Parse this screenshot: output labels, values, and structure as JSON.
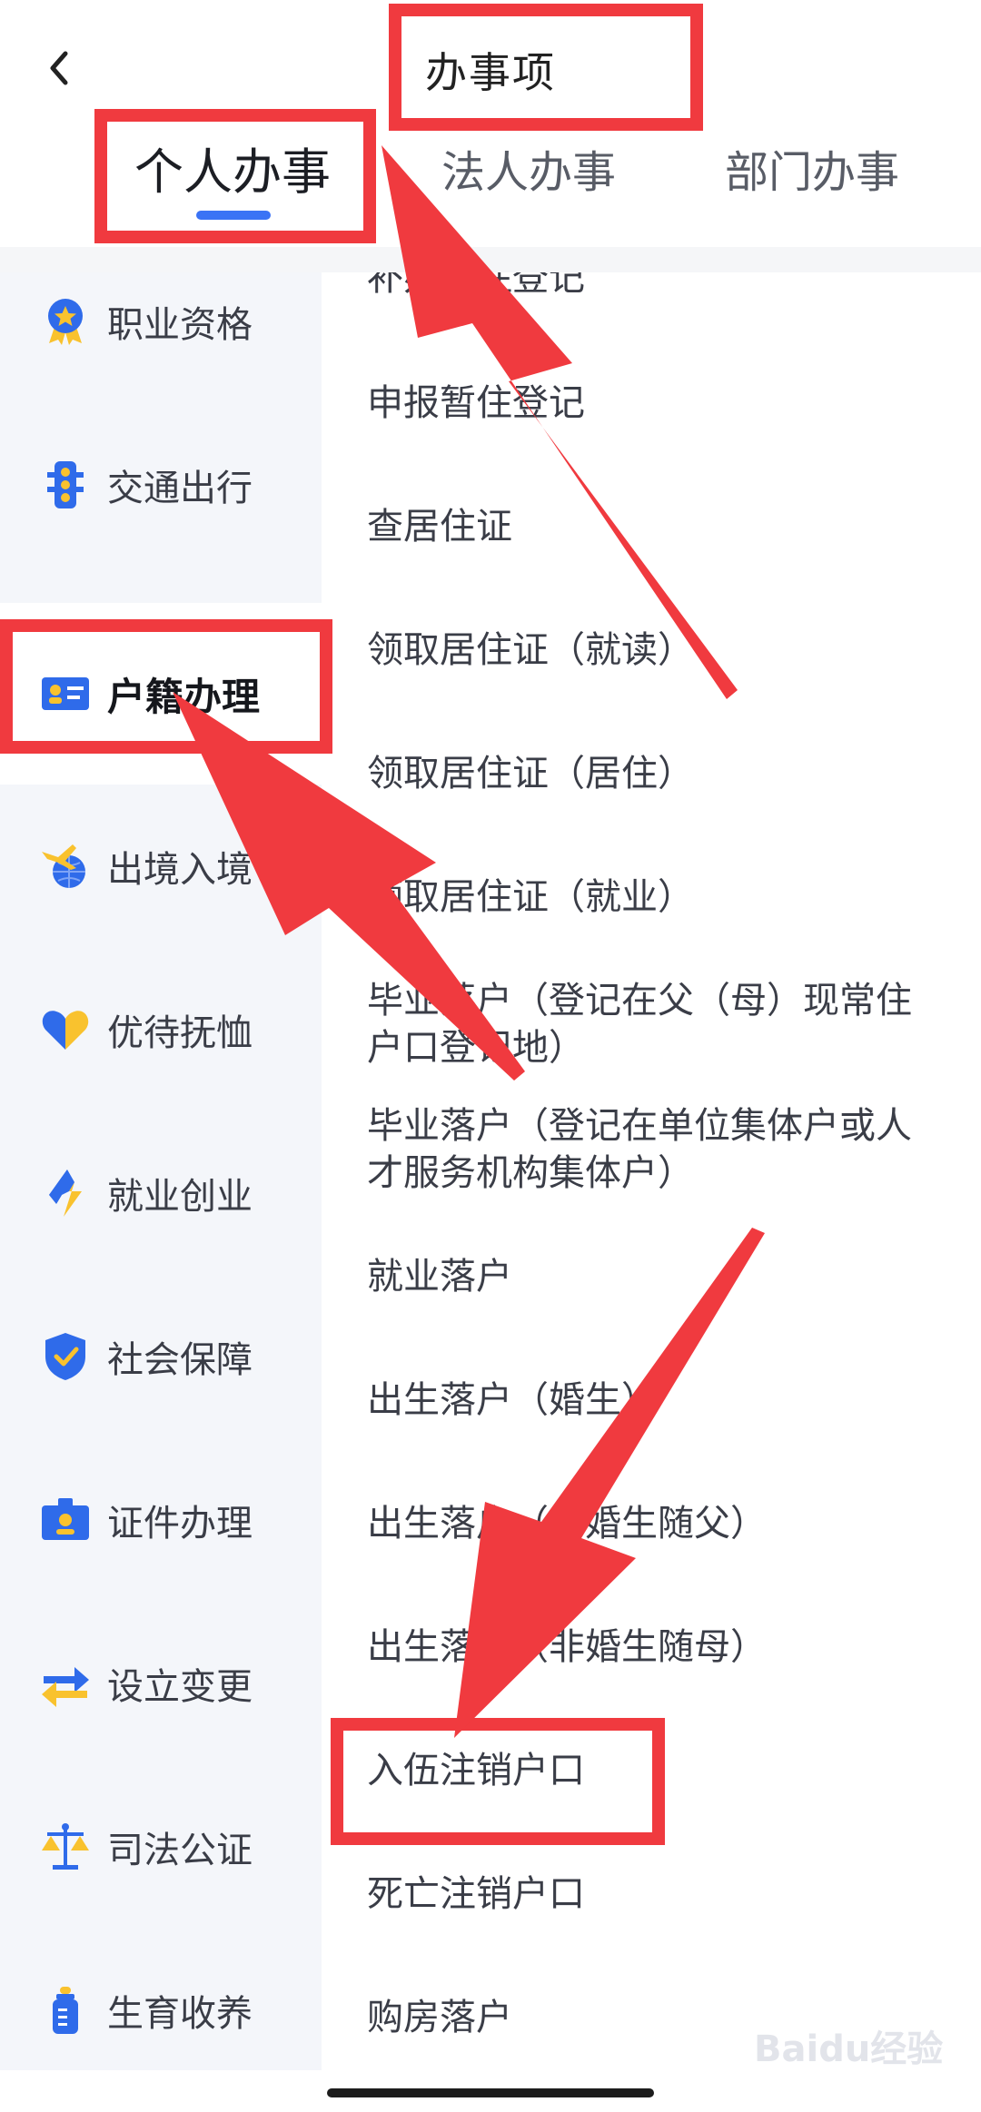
{
  "header": {
    "title": "办事项",
    "back_icon": "chevron-left-icon"
  },
  "tabs": [
    {
      "label": "个人办事",
      "active": true
    },
    {
      "label": "法人办事",
      "active": false
    },
    {
      "label": "部门办事",
      "active": false
    }
  ],
  "sidebar": {
    "items": [
      {
        "label": "职业资格",
        "icon": "medal-icon"
      },
      {
        "label": "交通出行",
        "icon": "traffic-light-icon"
      },
      {
        "label": "户籍办理",
        "icon": "id-card-icon",
        "active": true
      },
      {
        "label": "出境入境",
        "icon": "plane-globe-icon"
      },
      {
        "label": "优待抚恤",
        "icon": "heart-icon"
      },
      {
        "label": "就业创业",
        "icon": "lightning-icon"
      },
      {
        "label": "社会保障",
        "icon": "shield-check-icon"
      },
      {
        "label": "证件办理",
        "icon": "certificate-icon"
      },
      {
        "label": "设立变更",
        "icon": "swap-arrows-icon"
      },
      {
        "label": "司法公证",
        "icon": "scales-icon"
      },
      {
        "label": "生育收养",
        "icon": "baby-bottle-icon"
      }
    ]
  },
  "services": [
    {
      "line1": "补办暂住登记",
      "line2": ""
    },
    {
      "line1": "申报暂住登记",
      "line2": ""
    },
    {
      "line1": "查居住证",
      "line2": ""
    },
    {
      "line1": "领取居住证（就读）",
      "line2": ""
    },
    {
      "line1": "领取居住证（居住）",
      "line2": ""
    },
    {
      "line1": "领取居住证（就业）",
      "line2": ""
    },
    {
      "line1": "毕业落户（登记在父（母）现常住",
      "line2": "户口登记地）"
    },
    {
      "line1": "毕业落户（登记在单位集体户或人",
      "line2": "才服务机构集体户）"
    },
    {
      "line1": "就业落户",
      "line2": ""
    },
    {
      "line1": "出生落户（婚生）",
      "line2": ""
    },
    {
      "line1": "出生落户（非婚生随父）",
      "line2": ""
    },
    {
      "line1": "出生落户（非婚生随母）",
      "line2": ""
    },
    {
      "line1": "入伍注销户口",
      "line2": ""
    },
    {
      "line1": "死亡注销户口",
      "line2": ""
    },
    {
      "line1": "购房落户",
      "line2": ""
    }
  ],
  "colors": {
    "accent": "#3b73f5",
    "annotation": "#f03a3f",
    "sidebar_bg": "#f4f6fa",
    "icon_blue": "#2f6bea",
    "icon_yellow": "#f9c22e"
  },
  "watermark": {
    "text": "Baidu经验"
  }
}
